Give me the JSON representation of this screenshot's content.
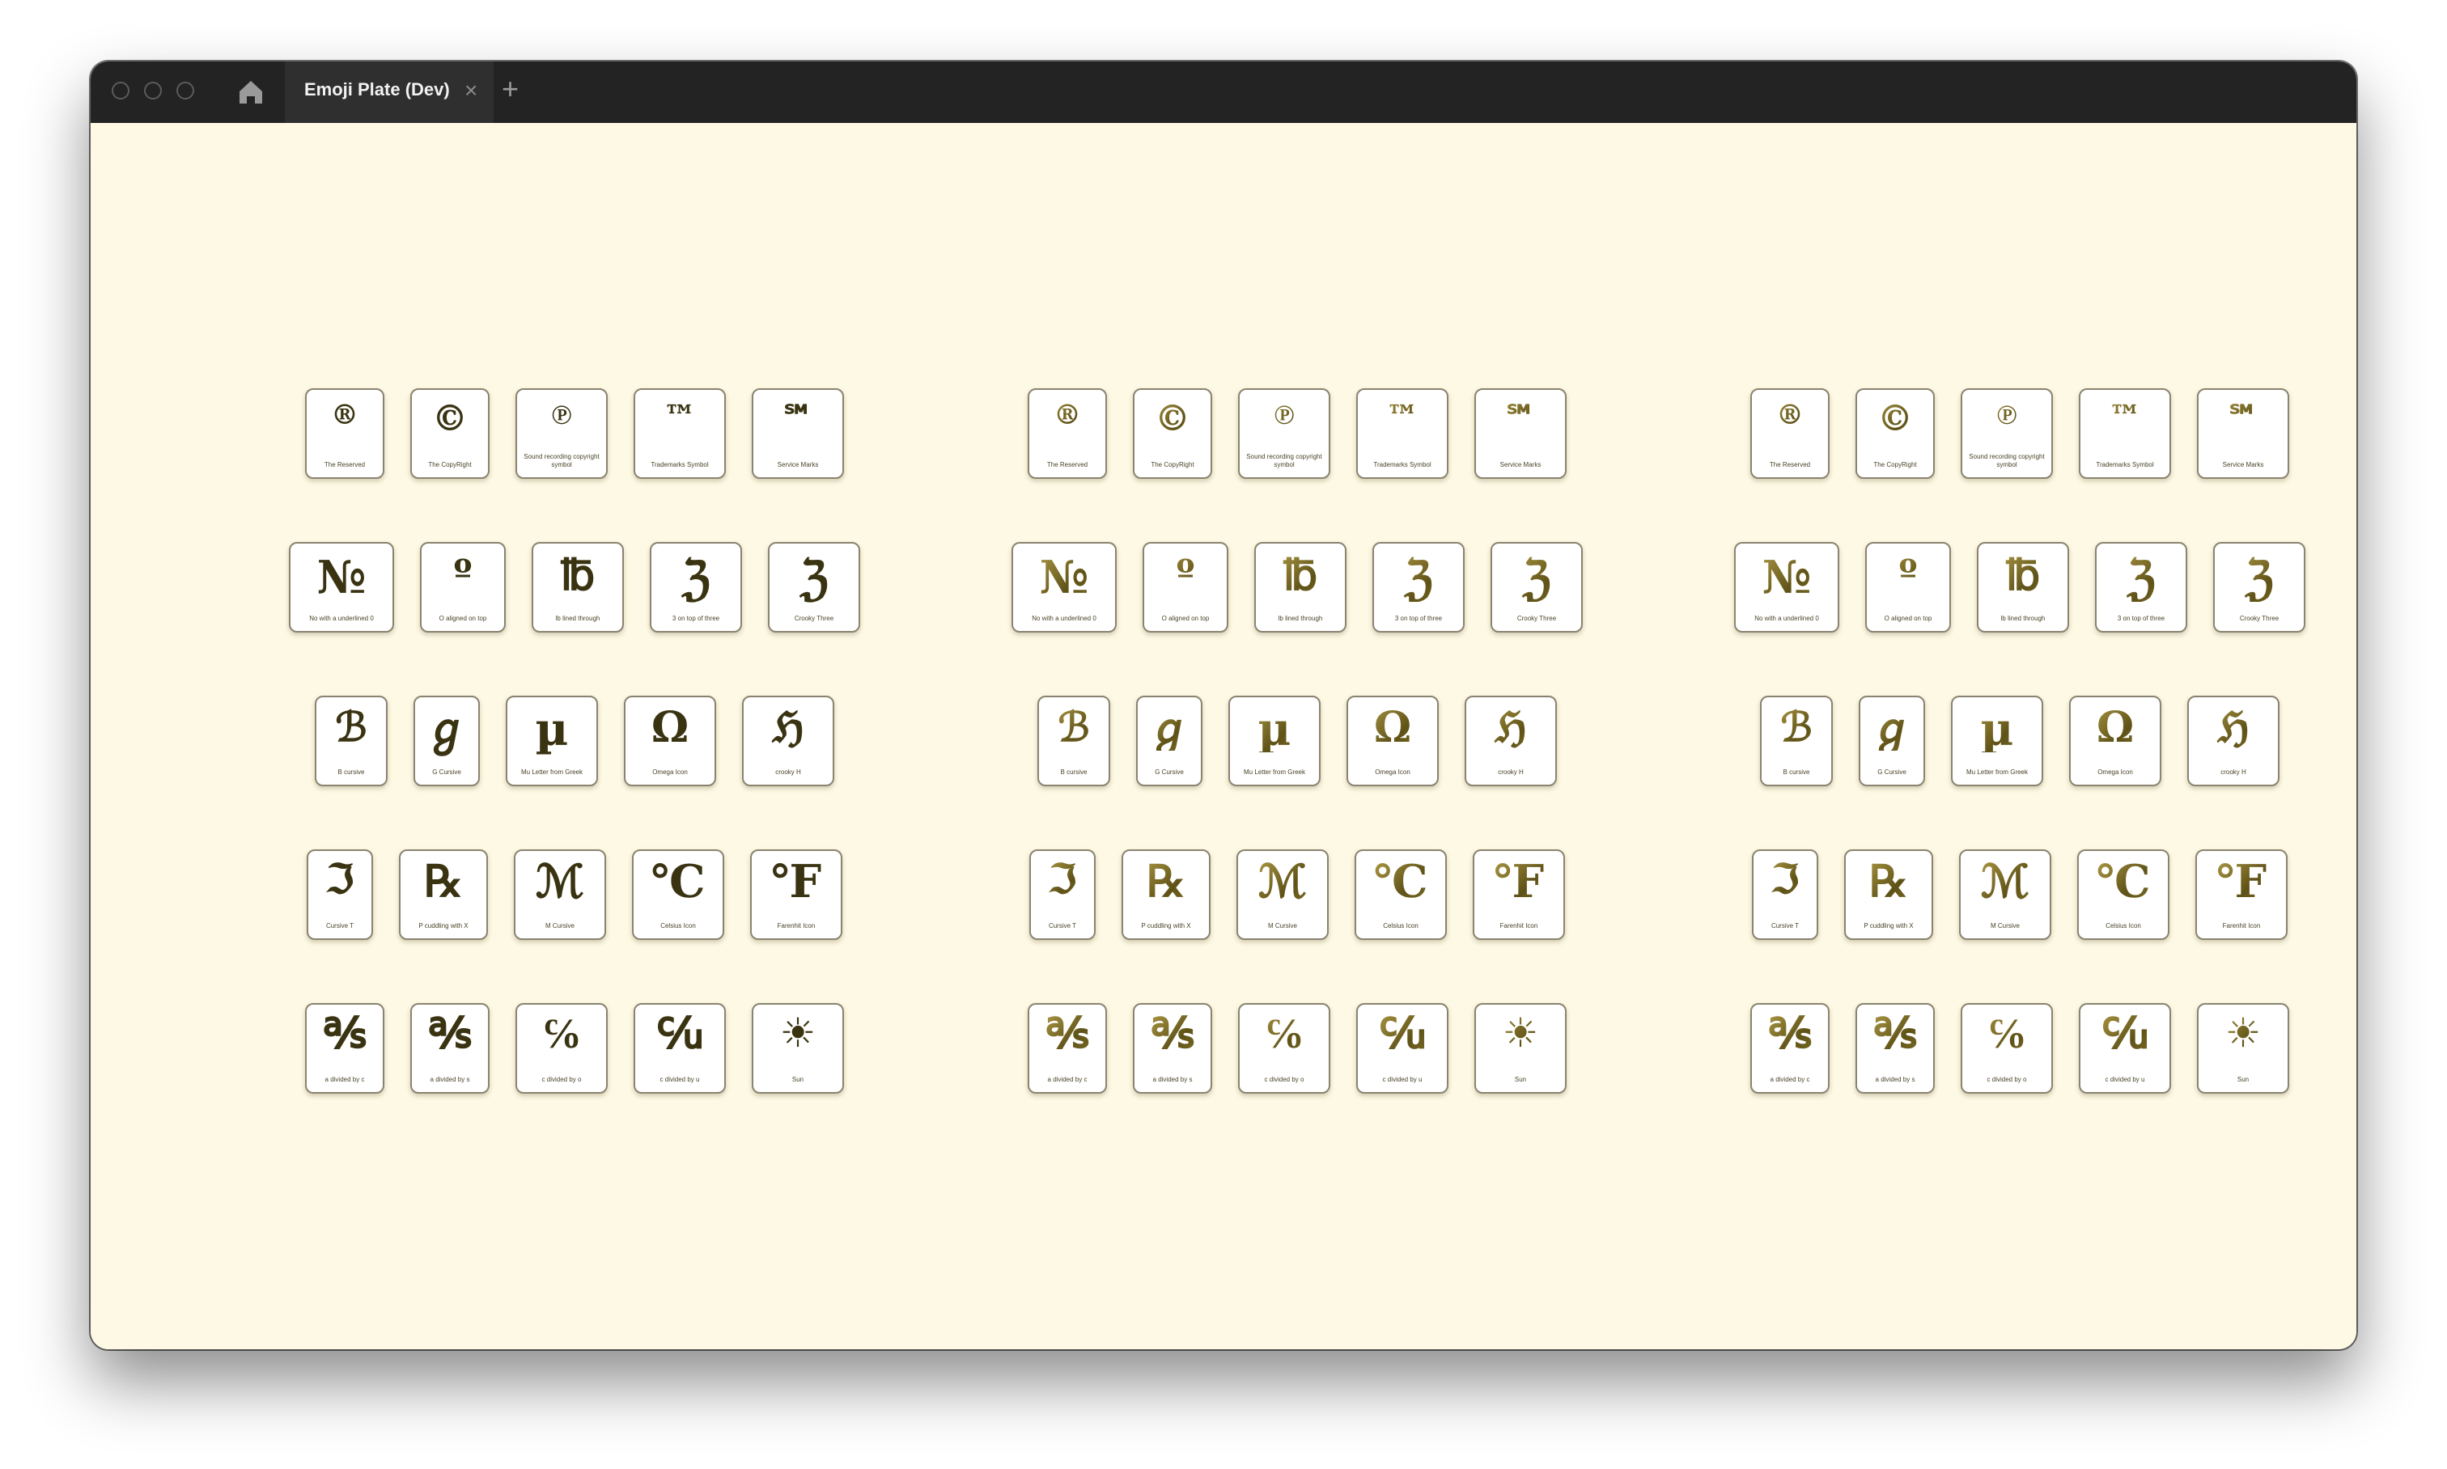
{
  "window": {
    "tab_title": "Emoji Plate (Dev)",
    "close_glyph": "×",
    "new_tab_glyph": "+"
  },
  "plates": [
    {
      "style": "dark"
    },
    {
      "style": "gold"
    },
    {
      "style": "gold"
    }
  ],
  "rows": [
    [
      {
        "glyph": "®",
        "label": "The Reserved",
        "w": 98,
        "size": 34
      },
      {
        "glyph": "©",
        "label": "The CopyRight",
        "w": 98,
        "size": 44
      },
      {
        "glyph": "℗",
        "label": "Sound recording copyright symbol",
        "w": 114,
        "size": 34
      },
      {
        "glyph": "™",
        "label": "Trademarks Symbol",
        "w": 114,
        "size": 40
      },
      {
        "glyph": "℠",
        "label": "Service Marks",
        "w": 114,
        "size": 40
      }
    ],
    [
      {
        "glyph": "№",
        "label": "No with a underlined 0",
        "w": 130,
        "size": 56
      },
      {
        "glyph": "º",
        "label": "O aligned on top",
        "w": 106,
        "size": 46
      },
      {
        "glyph": "℔",
        "label": "lb lined through",
        "w": 114,
        "size": 52
      },
      {
        "glyph": "ℨ",
        "label": "3 on top of three",
        "w": 114,
        "size": 58
      },
      {
        "glyph": "ℨ",
        "label": "Crooky Three",
        "w": 114,
        "size": 58
      }
    ],
    [
      {
        "glyph": "ℬ",
        "label": "B cursive",
        "w": 90,
        "size": 50
      },
      {
        "glyph": "ℊ",
        "label": "G Cursive",
        "w": 82,
        "size": 54
      },
      {
        "glyph": "µ",
        "label": "Mu Letter from Greek",
        "w": 114,
        "size": 56
      },
      {
        "glyph": "Ω",
        "label": "Omega Icon",
        "w": 114,
        "size": 52
      },
      {
        "glyph": "ℌ",
        "label": "crooky H",
        "w": 114,
        "size": 52
      }
    ],
    [
      {
        "glyph": "ℑ",
        "label": "Cursive T",
        "w": 82,
        "size": 50
      },
      {
        "glyph": "℞",
        "label": "P cuddling with X",
        "w": 110,
        "size": 54
      },
      {
        "glyph": "ℳ",
        "label": "M Cursive",
        "w": 114,
        "size": 56
      },
      {
        "glyph": "℃",
        "label": "Celsius Icon",
        "w": 114,
        "size": 56
      },
      {
        "glyph": "℉",
        "label": "Farenhit Icon",
        "w": 114,
        "size": 56
      }
    ],
    [
      {
        "glyph": "℁",
        "label": "a divided by c",
        "w": 98,
        "size": 52
      },
      {
        "glyph": "℁",
        "label": "a divided by s",
        "w": 98,
        "size": 52
      },
      {
        "glyph": "℅",
        "label": "c divided by o",
        "w": 114,
        "size": 52
      },
      {
        "glyph": "℆",
        "label": "c divided by u",
        "w": 114,
        "size": 52
      },
      {
        "glyph": "☀",
        "label": "Sun",
        "w": 114,
        "size": 50
      }
    ]
  ]
}
